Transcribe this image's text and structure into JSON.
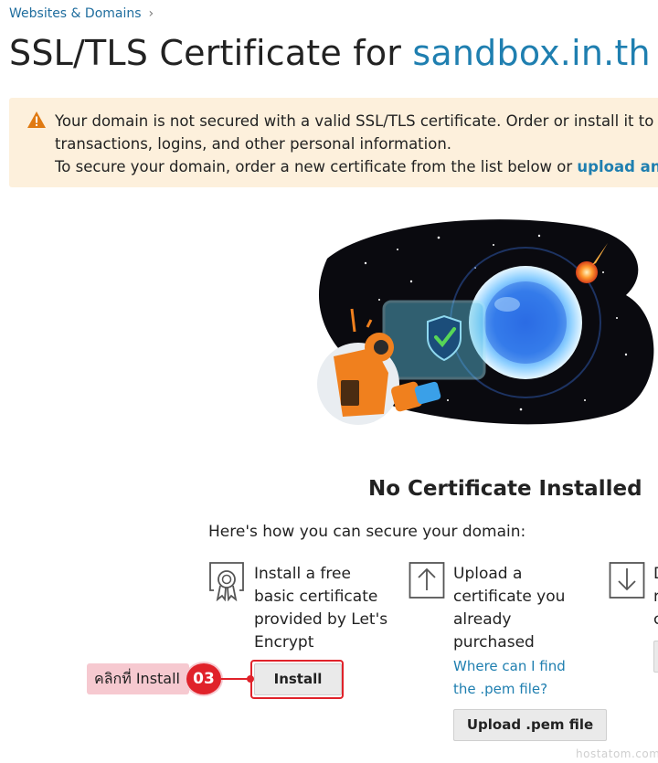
{
  "breadcrumb": {
    "item": "Websites & Domains"
  },
  "title": {
    "prefix": "SSL/TLS Certificate for ",
    "domain": "sandbox.in.th"
  },
  "alert": {
    "line1": "Your domain is not secured with a valid SSL/TLS certificate. Order or install it to se",
    "line2": "transactions, logins, and other personal information.",
    "line3_text": "To secure your domain, order a new certificate from the list below or ",
    "line3_link": "upload an a"
  },
  "status": {
    "title": "No Certificate Installed"
  },
  "subtitle": "Here's how you can secure your domain:",
  "options": [
    {
      "lines": [
        "Install a free",
        "basic certificate",
        "provided by Let's",
        "Encrypt"
      ],
      "button": "Install"
    },
    {
      "lines": [
        "Upload a",
        "certificate you",
        "already",
        "purchased"
      ],
      "link_lines": [
        "Where can I find",
        "the .pem file?"
      ],
      "button": "Upload .pem file"
    },
    {
      "lines": [
        "D",
        "r",
        "c"
      ]
    }
  ],
  "callout": {
    "label": "คลิกที่ Install",
    "number": "03"
  },
  "watermark": "hostatom.com",
  "colors": {
    "link": "#1f7fb0",
    "alert_bg": "#fdf0dc",
    "warning": "#e07a12",
    "callout_red": "#e0222a",
    "callout_pink": "#f6c9d0"
  }
}
